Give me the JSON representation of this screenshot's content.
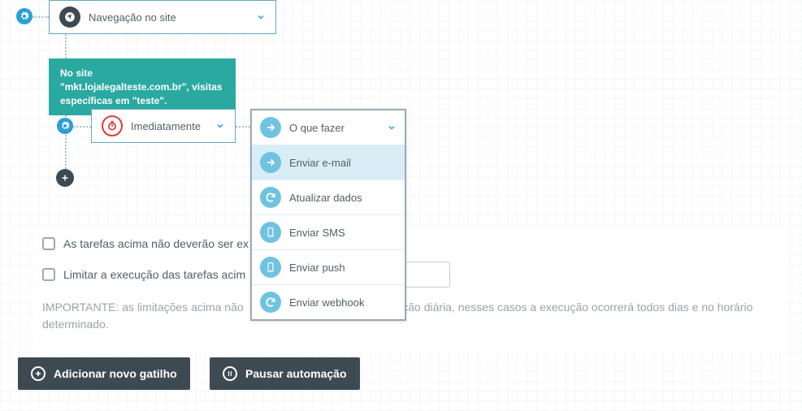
{
  "trigger": {
    "label": "Navegação no site",
    "description": "No site \"mkt.lojalegalteste.com.br\", visitas específicas em \"teste\"."
  },
  "timing": {
    "label": "Imediatamente"
  },
  "action": {
    "head_label": "O que fazer",
    "options": [
      {
        "label": "Enviar e-mail",
        "icon": "arrow"
      },
      {
        "label": "Atualizar dados",
        "icon": "refresh"
      },
      {
        "label": "Enviar SMS",
        "icon": "phone"
      },
      {
        "label": "Enviar push",
        "icon": "phone"
      },
      {
        "label": "Enviar webhook",
        "icon": "refresh"
      }
    ]
  },
  "options_block": {
    "chk1_label": "As tarefas acima não deverão ser ex",
    "chk2_label": "Limitar a execução das tarefas acim",
    "note_part1": "IMPORTANTE: as limitações acima não",
    "note_part2": "ficação diária, nesses casos a execução ocorrerá todos dias e no horário determinado."
  },
  "buttons": {
    "add_trigger": "Adicionar novo gatilho",
    "pause": "Pausar automação"
  }
}
